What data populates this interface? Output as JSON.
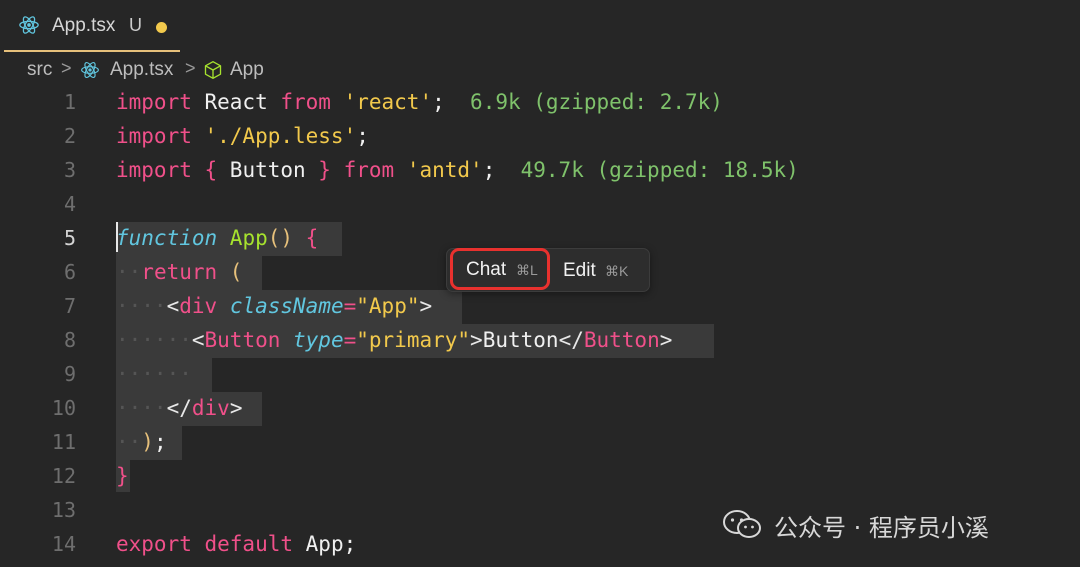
{
  "tab": {
    "filename": "App.tsx",
    "status": "U",
    "icon": "react-icon"
  },
  "breadcrumb": {
    "folder": "src",
    "file": "App.tsx",
    "symbol": "App",
    "separator": ">"
  },
  "line_numbers": [
    "1",
    "2",
    "3",
    "4",
    "5",
    "6",
    "7",
    "8",
    "9",
    "10",
    "11",
    "12",
    "13",
    "14"
  ],
  "active_line": "5",
  "code": {
    "l1": {
      "import": "import",
      "name": " React ",
      "from": "from",
      "src": " 'react'",
      "semi": ";",
      "size": "  6.9k (gzipped: 2.7k)"
    },
    "l2": {
      "import": "import",
      "src": " './App.less'",
      "semi": ";"
    },
    "l3": {
      "import": "import",
      "lb": " { ",
      "name": "Button",
      "rb": " } ",
      "from": "from",
      "src": " 'antd'",
      "semi": ";",
      "size": "  49.7k (gzipped: 18.5k)"
    },
    "l5": {
      "function": "function",
      "name": " App",
      "parens": "()",
      "brace": " {"
    },
    "l6": {
      "indent": "··",
      "ret": "return",
      "paren": " ("
    },
    "l7": {
      "indent": "····",
      "lt": "<",
      "tag": "div",
      "attr": " className",
      "eq": "=",
      "val": "\"App\"",
      "gt": ">"
    },
    "l8": {
      "indent": "······",
      "lt": "<",
      "tag": "Button",
      "attr": " type",
      "eq": "=",
      "val": "\"primary\"",
      "gt": ">",
      "text": "Button",
      "close_lt": "</",
      "close_tag": "Button",
      "close_gt": ">"
    },
    "l9": {
      "indent": "······"
    },
    "l10": {
      "indent": "····",
      "close_lt": "</",
      "tag": "div",
      "gt": ">"
    },
    "l11": {
      "indent": "··",
      "paren": ")",
      "semi": ";"
    },
    "l12": {
      "brace": "}"
    },
    "l14": {
      "export": "export",
      "default": " default",
      "name": " App",
      "semi": ";"
    }
  },
  "popup": {
    "chat_label": "Chat",
    "chat_shortcut": "⌘L",
    "edit_label": "Edit",
    "edit_shortcut": "⌘K"
  },
  "watermark": {
    "icon": "wechat-icon",
    "text": "公众号 · 程序员小溪"
  }
}
